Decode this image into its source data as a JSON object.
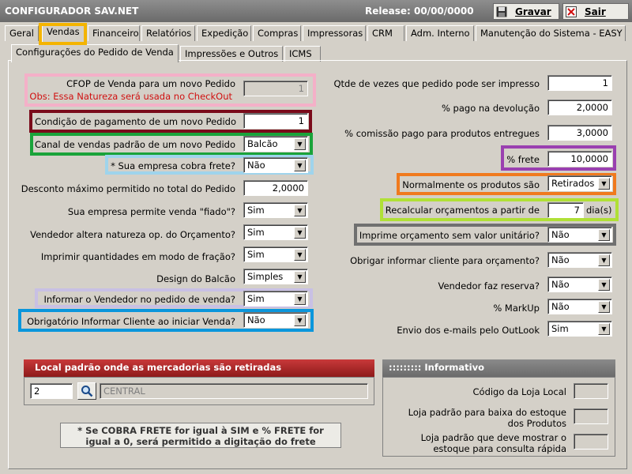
{
  "window": {
    "title": "CONFIGURADOR SAV.NET",
    "release": "Release: 00/00/0000",
    "save_label": "Gravar",
    "exit_label": "Sair"
  },
  "main_tabs": [
    "Geral",
    "Vendas",
    "Financeiro",
    "Relatórios",
    "Expedição",
    "Compras",
    "Impressoras",
    "CRM",
    "Adm. Interno",
    "Manutenção do Sistema - EASY"
  ],
  "sub_tabs": [
    "Configurações do Pedido de Venda",
    "Impressões e Outros",
    "ICMS"
  ],
  "left": {
    "cfop_label": "CFOP de Venda para um novo Pedido",
    "cfop_note": "Obs: Essa Natureza será usada no CheckOut",
    "cfop_value": "1",
    "cond_label": "Condição de pagamento de um novo Pedido",
    "cond_value": "1",
    "canal_label": "Canal de vendas padrão de um novo Pedido",
    "canal_value": "Balcão",
    "frete_label": "* Sua empresa cobra frete?",
    "frete_value": "Não",
    "desconto_label": "Desconto máximo permitido no total do Pedido",
    "desconto_value": "2,0000",
    "fiado_label": "Sua empresa permite venda \"fiado\"?",
    "fiado_value": "Sim",
    "natureza_label": "Vendedor altera natureza op. do Orçamento?",
    "natureza_value": "Sim",
    "fracao_label": "Imprimir quantidades em modo de fração?",
    "fracao_value": "Sim",
    "design_label": "Design do Balcão",
    "design_value": "Simples",
    "informar_vend_label": "Informar o Vendedor no pedido de venda?",
    "informar_vend_value": "Sim",
    "obrig_cliente_label": "Obrigatório Informar Cliente ao iniciar Venda?",
    "obrig_cliente_value": "Não"
  },
  "right": {
    "qtde_imp_label": "Qtde de vezes que pedido pode ser impresso",
    "qtde_imp_value": "1",
    "pago_dev_label": "% pago na devolução",
    "pago_dev_value": "2,0000",
    "comissao_label": "% comissão pago para produtos entregues",
    "comissao_value": "3,0000",
    "pfrete_label": "% frete",
    "pfrete_value": "10,0000",
    "normal_label": "Normalmente os produtos são",
    "normal_value": "Retirados",
    "recalc_label": "Recalcular orçamentos a partir de",
    "recalc_value": "7",
    "recalc_unit": "dia(s)",
    "sem_valor_label": "Imprime orçamento sem valor unitário?",
    "sem_valor_value": "Não",
    "obrig_orc_label": "Obrigar informar cliente para orçamento?",
    "obrig_orc_value": "Não",
    "reserva_label": "Vendedor faz reserva?",
    "reserva_value": "Não",
    "markup_label": "% MarkUp",
    "markup_value": "Não",
    "outlook_label": "Envio dos e-mails pelo OutLook",
    "outlook_value": "Sim"
  },
  "local": {
    "title": "Local padrão onde as mercadorias são retiradas",
    "code": "2",
    "name": "CENTRAL"
  },
  "info": {
    "title": ":::::::::  Informativo",
    "loja_local_label": "Código da Loja Local",
    "loja_baixa_label1": "Loja padrão para baixa do estoque",
    "loja_baixa_label2": "dos Produtos",
    "loja_mostrar_label1": "Loja padrão que deve mostrar o",
    "loja_mostrar_label2": "estoque para consulta rápida"
  },
  "note": {
    "line1": "* Se COBRA FRETE for igual à SIM e % FRETE for",
    "line2": "igual a 0, será permitido a digitação do frete"
  },
  "colors": {
    "pink": "#f4b0c8",
    "maroon": "#7a0a1a",
    "green": "#1aa33a",
    "light_blue": "#9fd4ec",
    "lavender": "#c8c0e4",
    "blue": "#0a96dc",
    "purple": "#9a40b0",
    "orange": "#f07a1e",
    "lime": "#b0e036",
    "gray": "#707070",
    "yellow": "#f4b400"
  }
}
